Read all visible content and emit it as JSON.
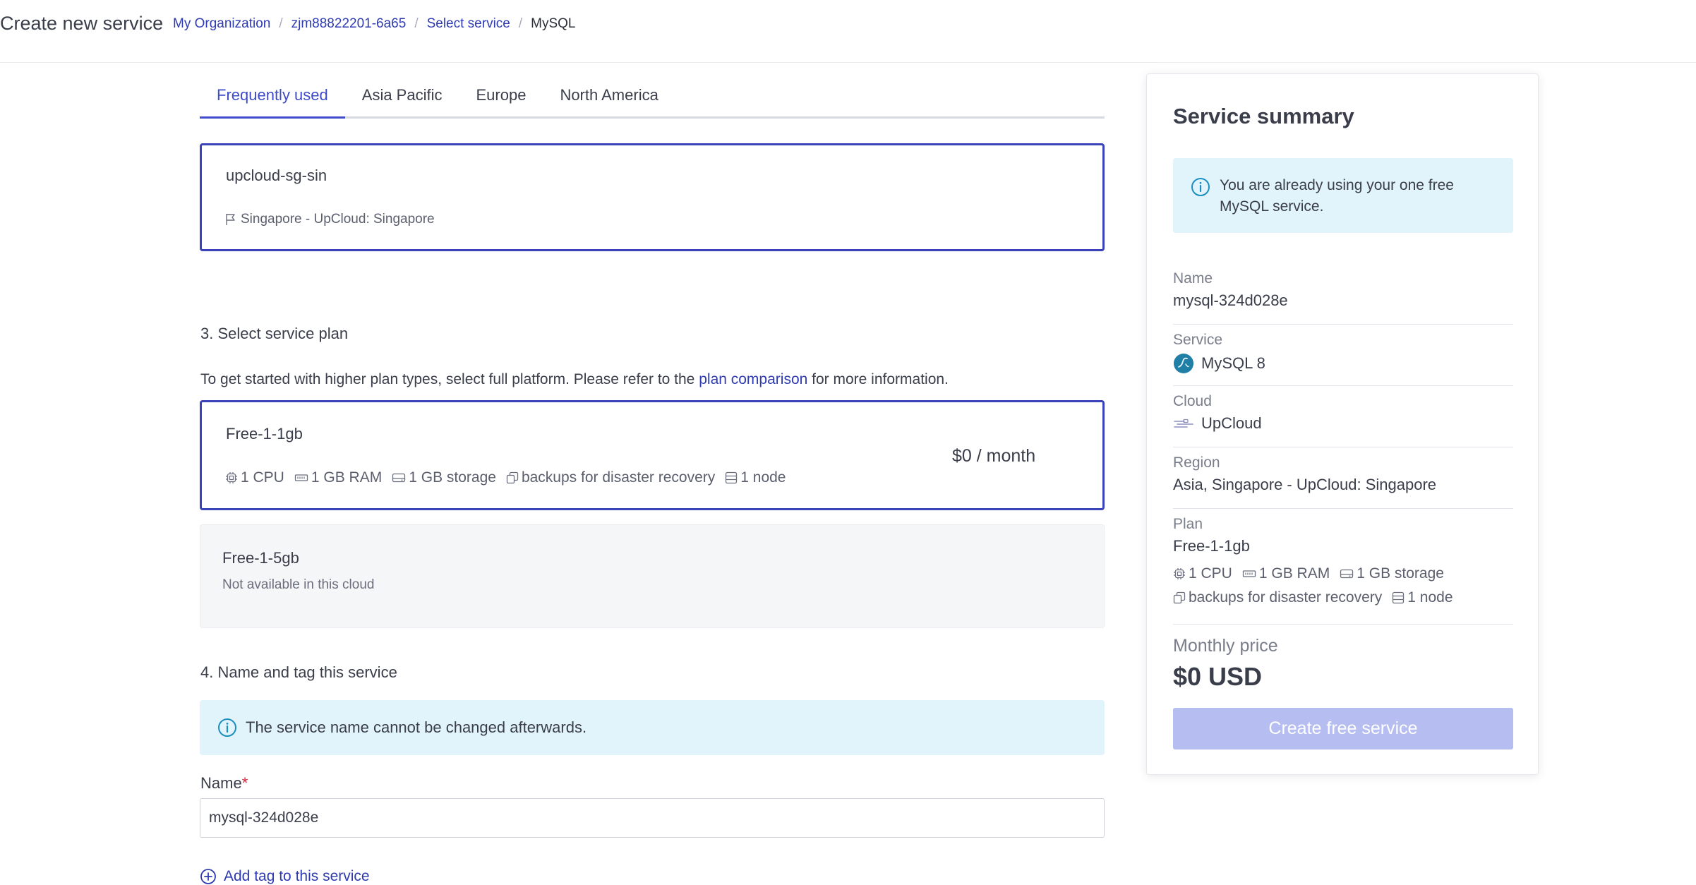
{
  "header": {
    "title": "Create new service",
    "breadcrumb": [
      "My Organization",
      "zjm88822201-6a65",
      "Select service"
    ],
    "breadcrumb_current": "MySQL",
    "separator": "/"
  },
  "region_tabs": [
    "Frequently used",
    "Asia Pacific",
    "Europe",
    "North America"
  ],
  "selected_region": {
    "name": "upcloud-sg-sin",
    "location": "Singapore - UpCloud: Singapore"
  },
  "plan_section": {
    "title": "3. Select service plan",
    "info_prefix": "To get started with higher plan types, select full platform. Please refer to the",
    "info_link": "plan comparison",
    "info_suffix": "for more information.",
    "plans": [
      {
        "name": "Free-1-1gb",
        "price": "$0 / month",
        "specs": {
          "cpu": "1 CPU",
          "ram": "1 GB RAM",
          "storage": "1 GB storage",
          "backups": "backups for disaster recovery",
          "nodes": "1 node"
        }
      },
      {
        "name": "Free-1-5gb",
        "note": "Not available in this cloud"
      }
    ]
  },
  "name_section": {
    "title": "4. Name and tag this service",
    "banner": "The service name cannot be changed afterwards.",
    "label": "Name",
    "required_mark": "*",
    "value": "mysql-324d028e",
    "add_tag": "Add tag to this service"
  },
  "summary": {
    "title": "Service summary",
    "banner": "You are already using your one free MySQL service.",
    "name_label": "Name",
    "name_value": "mysql-324d028e",
    "service_label": "Service",
    "service_value": "MySQL 8",
    "cloud_label": "Cloud",
    "cloud_value": "UpCloud",
    "region_label": "Region",
    "region_value": "Asia, Singapore - UpCloud: Singapore",
    "plan_label": "Plan",
    "plan_value": "Free-1-1gb",
    "specs": {
      "cpu": "1 CPU",
      "ram": "1 GB RAM",
      "storage": "1 GB storage",
      "backups": "backups for disaster recovery",
      "nodes": "1 node"
    },
    "monthly_label": "Monthly price",
    "monthly_value": "$0 USD",
    "create_button": "Create free service"
  },
  "colors": {
    "accent": "#3f4bc8",
    "link": "#2f3bb0",
    "info_bg": "#e1f3fb",
    "info_icon": "#1b8fc0",
    "button_disabled": "#b6bdf0",
    "required": "#d0263a"
  },
  "icons": [
    "flag-icon",
    "cpu-icon",
    "ram-icon",
    "storage-icon",
    "backups-icon",
    "node-icon",
    "info-icon",
    "mysql-icon",
    "upcloud-icon",
    "plus-circle-icon"
  ]
}
